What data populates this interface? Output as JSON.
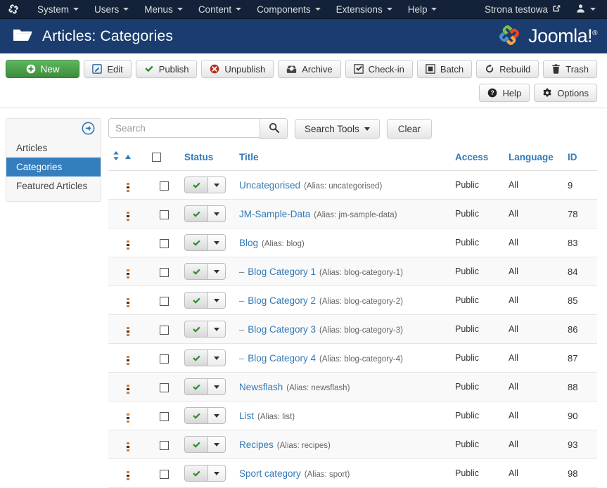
{
  "topnav": {
    "brand_icon": "joomla-mark-icon",
    "items": [
      {
        "label": "System",
        "has_caret": true
      },
      {
        "label": "Users",
        "has_caret": true
      },
      {
        "label": "Menus",
        "has_caret": true
      },
      {
        "label": "Content",
        "has_caret": true
      },
      {
        "label": "Components",
        "has_caret": true
      },
      {
        "label": "Extensions",
        "has_caret": true
      },
      {
        "label": "Help",
        "has_caret": true
      }
    ],
    "site_label": "Strona testowa",
    "site_icon": "external-link-icon",
    "user_icon": "user-icon"
  },
  "header": {
    "icon": "folder-open-icon",
    "title": "Articles: Categories",
    "logo_text": "Joomla!",
    "logo_registered": "®"
  },
  "toolbar": {
    "primary": [
      {
        "label": "New",
        "icon": "plus-circle-icon",
        "style": "success"
      },
      {
        "label": "Edit",
        "icon": "pencil-square-icon",
        "style": "default"
      },
      {
        "label": "Publish",
        "icon": "check-icon",
        "style": "default"
      },
      {
        "label": "Unpublish",
        "icon": "times-circle-icon",
        "style": "default"
      },
      {
        "label": "Archive",
        "icon": "archive-box-icon",
        "style": "default"
      },
      {
        "label": "Check-in",
        "icon": "checkbox-icon",
        "style": "default"
      },
      {
        "label": "Batch",
        "icon": "square-icon",
        "style": "default"
      },
      {
        "label": "Rebuild",
        "icon": "refresh-icon",
        "style": "default"
      },
      {
        "label": "Trash",
        "icon": "trash-icon",
        "style": "default"
      }
    ],
    "secondary": [
      {
        "label": "Help",
        "icon": "question-circle-icon"
      },
      {
        "label": "Options",
        "icon": "gear-icon"
      }
    ]
  },
  "sidebar": {
    "toggle_icon": "arrow-circle-left-icon",
    "items": [
      {
        "label": "Articles",
        "active": false
      },
      {
        "label": "Categories",
        "active": true
      },
      {
        "label": "Featured Articles",
        "active": false
      }
    ]
  },
  "search": {
    "value": "",
    "placeholder": "Search",
    "search_icon": "search-icon",
    "tools_label": "Search Tools",
    "clear_label": "Clear"
  },
  "table": {
    "headers": {
      "ordering": "",
      "checkbox": "",
      "status": "Status",
      "title": "Title",
      "access": "Access",
      "language": "Language",
      "id": "ID"
    },
    "sort_icons": [
      "sort-icon",
      "sort-asc-icon"
    ],
    "alias_prefix": "Alias: ",
    "rows": [
      {
        "indent": "",
        "title": "Uncategorised",
        "alias": "uncategorised",
        "access": "Public",
        "language": "All",
        "id": "9",
        "status": "published"
      },
      {
        "indent": "",
        "title": "JM-Sample-Data",
        "alias": "jm-sample-data",
        "access": "Public",
        "language": "All",
        "id": "78",
        "status": "published"
      },
      {
        "indent": "",
        "title": "Blog",
        "alias": "blog",
        "access": "Public",
        "language": "All",
        "id": "83",
        "status": "published"
      },
      {
        "indent": "–",
        "title": "Blog Category 1",
        "alias": "blog-category-1",
        "access": "Public",
        "language": "All",
        "id": "84",
        "status": "published"
      },
      {
        "indent": "–",
        "title": "Blog Category 2",
        "alias": "blog-category-2",
        "access": "Public",
        "language": "All",
        "id": "85",
        "status": "published"
      },
      {
        "indent": "–",
        "title": "Blog Category 3",
        "alias": "blog-category-3",
        "access": "Public",
        "language": "All",
        "id": "86",
        "status": "published"
      },
      {
        "indent": "–",
        "title": "Blog Category 4",
        "alias": "blog-category-4",
        "access": "Public",
        "language": "All",
        "id": "87",
        "status": "published"
      },
      {
        "indent": "",
        "title": "Newsflash",
        "alias": "newsflash",
        "access": "Public",
        "language": "All",
        "id": "88",
        "status": "published"
      },
      {
        "indent": "",
        "title": "List",
        "alias": "list",
        "access": "Public",
        "language": "All",
        "id": "90",
        "status": "published"
      },
      {
        "indent": "",
        "title": "Recipes",
        "alias": "recipes",
        "access": "Public",
        "language": "All",
        "id": "93",
        "status": "published"
      },
      {
        "indent": "",
        "title": "Sport category",
        "alias": "sport",
        "access": "Public",
        "language": "All",
        "id": "98",
        "status": "published"
      }
    ]
  },
  "colors": {
    "topnav_bg": "#132239",
    "subhead_bg": "#1a3c6e",
    "accent_link": "#337ab7",
    "active_item": "#357ebd",
    "success": "#5cb85c",
    "danger": "#b94a48"
  }
}
